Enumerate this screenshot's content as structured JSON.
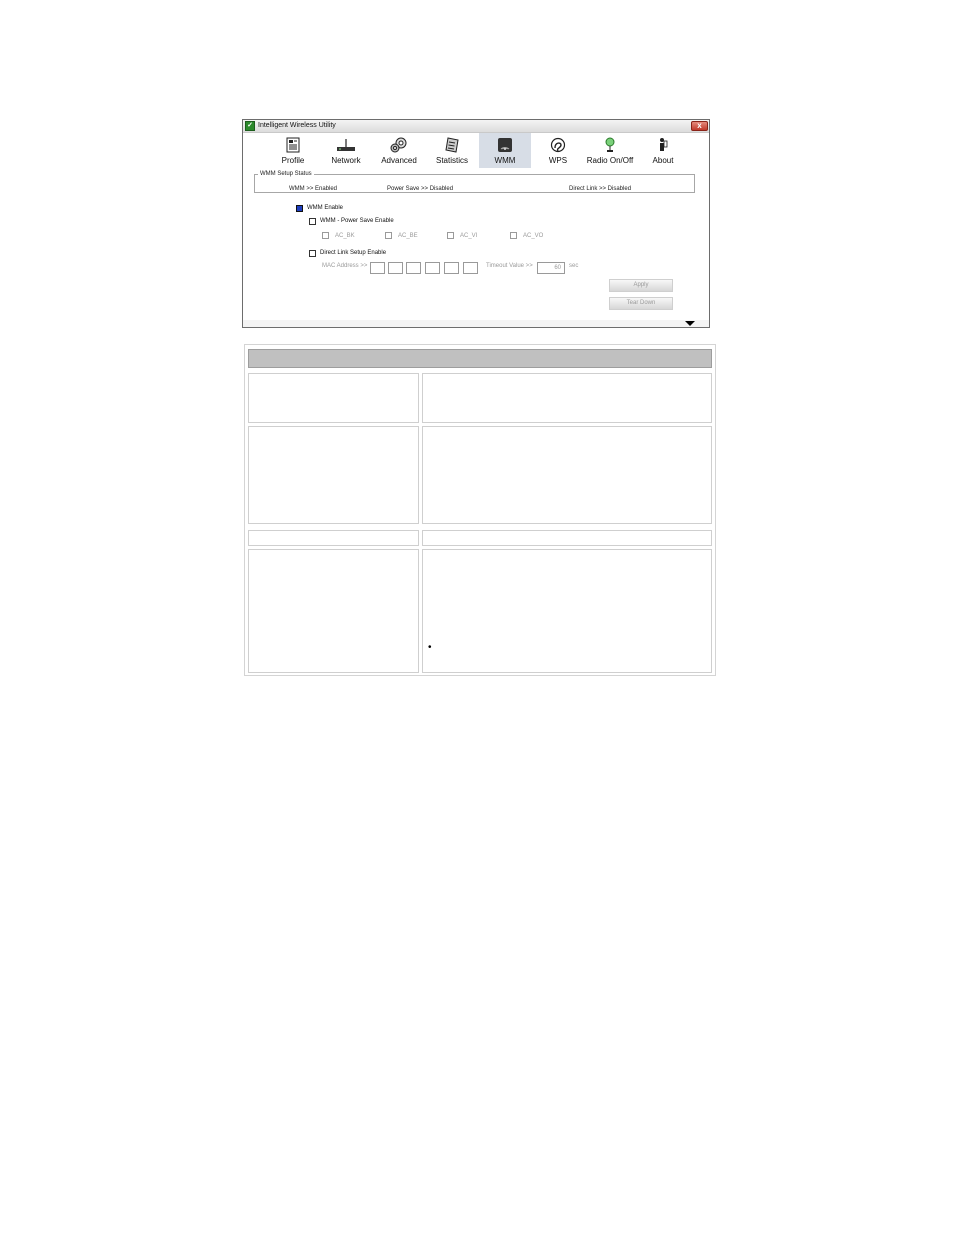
{
  "window": {
    "title": "Intelligent Wireless Utility",
    "icon_name": "utility-app-icon",
    "close_glyph": "x"
  },
  "toolbar": {
    "items": [
      {
        "label": "Profile",
        "icon": "profile-icon"
      },
      {
        "label": "Network",
        "icon": "network-icon"
      },
      {
        "label": "Advanced",
        "icon": "advanced-icon"
      },
      {
        "label": "Statistics",
        "icon": "statistics-icon"
      },
      {
        "label": "WMM",
        "icon": "wmm-icon",
        "active": true
      },
      {
        "label": "WPS",
        "icon": "wps-icon"
      },
      {
        "label": "Radio On/Off",
        "icon": "radio-icon"
      },
      {
        "label": "About",
        "icon": "about-icon"
      }
    ]
  },
  "status": {
    "legend": "WMM Setup Status",
    "wmm": "WMM >> Enabled",
    "power_save": "Power Save >> Disabled",
    "direct_link": "Direct Link >> Disabled"
  },
  "options": {
    "wmm_enable": {
      "label": "WMM Enable",
      "checked": true
    },
    "power_save_enable": {
      "label": "WMM - Power Save Enable",
      "checked": false
    },
    "ac": [
      "AC_BK",
      "AC_BE",
      "AC_VI",
      "AC_VO"
    ],
    "direct_link_enable": {
      "label": "Direct Link Setup Enable",
      "checked": false
    },
    "mac_address_label": "MAC Address >>",
    "timeout_label": "Timeout Value >>",
    "timeout_value": "60",
    "timeout_unit": "sec"
  },
  "buttons": {
    "apply": "Apply",
    "tear_down": "Tear Down"
  },
  "table": {
    "header": "",
    "bullet": "•"
  },
  "colors": {
    "active_tab": "#d7dde6",
    "checked_box": "#1f3fbf",
    "table_header": "#c0c0c0"
  }
}
